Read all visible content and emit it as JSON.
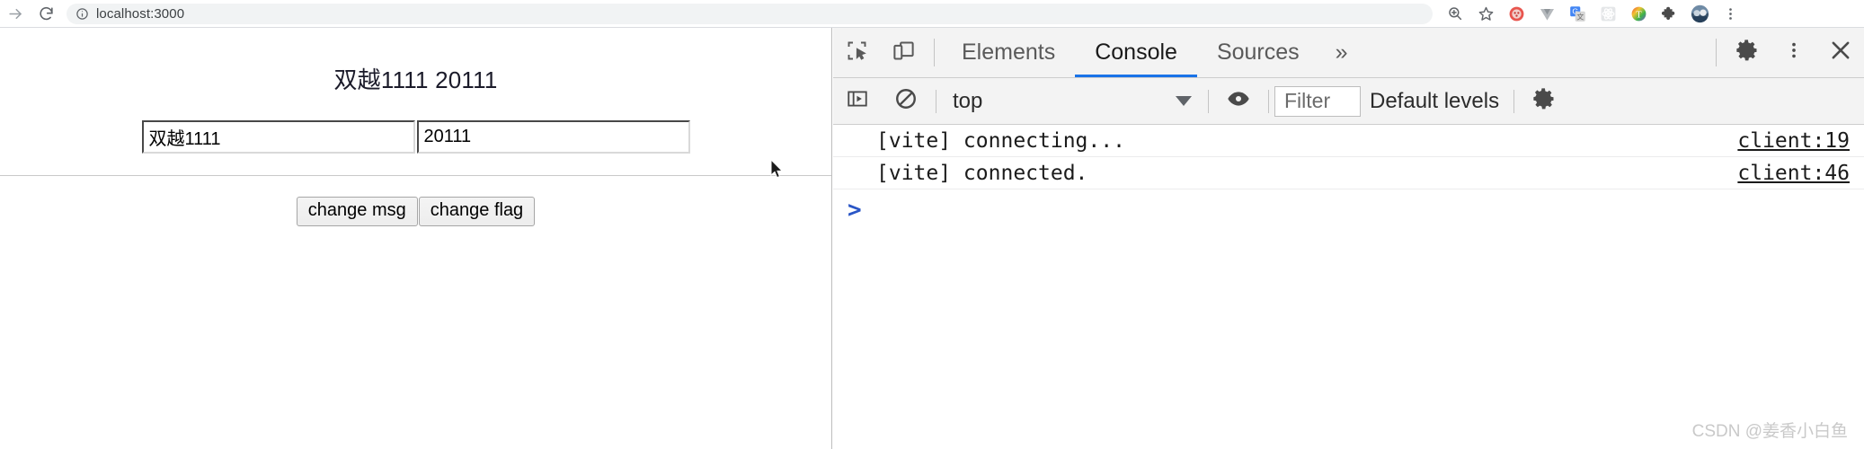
{
  "browser": {
    "forward_icon": "arrow-forward-icon",
    "reload_icon": "reload-icon",
    "omnibox": {
      "info_icon": "site-info-icon",
      "url": "localhost:3000"
    },
    "toolbar_icons": [
      {
        "name": "zoom-icon",
        "glyph": "search"
      },
      {
        "name": "bookmark-star-icon",
        "glyph": "star"
      },
      {
        "name": "extension-octopus-icon",
        "glyph": "red-circle"
      },
      {
        "name": "extension-vue-devtools-icon",
        "glyph": "gray-v"
      },
      {
        "name": "extension-google-translate-icon",
        "glyph": "g-translate"
      },
      {
        "name": "extension-react-devtools-icon",
        "glyph": "gray-dots"
      },
      {
        "name": "extension-colorful-t-icon",
        "glyph": "rainbow-t"
      },
      {
        "name": "extensions-puzzle-icon",
        "glyph": "puzzle"
      },
      {
        "name": "profile-avatar",
        "glyph": "avatar"
      },
      {
        "name": "chrome-menu-icon",
        "glyph": "kebab"
      }
    ]
  },
  "page": {
    "heading": "双越1111 20111",
    "inputs": [
      {
        "name": "msg-input",
        "value": "双越1111"
      },
      {
        "name": "flag-input",
        "value": "20111"
      }
    ],
    "buttons": [
      {
        "name": "change-msg-button",
        "label": "change msg"
      },
      {
        "name": "change-flag-button",
        "label": "change flag"
      }
    ]
  },
  "devtools": {
    "left_icons": [
      {
        "name": "inspect-element-icon"
      },
      {
        "name": "device-toolbar-icon"
      }
    ],
    "tabs": [
      {
        "label": "Elements",
        "active": false
      },
      {
        "label": "Console",
        "active": true
      },
      {
        "label": "Sources",
        "active": false
      }
    ],
    "more_tabs_label": "»",
    "right_icons": [
      {
        "name": "settings-gear-icon"
      },
      {
        "name": "devtools-menu-icon"
      },
      {
        "name": "close-devtools-icon"
      }
    ],
    "console_toolbar": {
      "sidebar_toggle_icon": "console-sidebar-icon",
      "clear_console_icon": "clear-console-icon",
      "context_label": "top",
      "live_expression_icon": "eye-icon",
      "filter_placeholder": "Filter",
      "levels_label": "Default levels",
      "settings_icon": "console-settings-gear-icon"
    },
    "messages": [
      {
        "text": "[vite] connecting...",
        "source": "client:19"
      },
      {
        "text": "[vite] connected.",
        "source": "client:46"
      }
    ],
    "prompt": ">"
  },
  "watermark": "CSDN @姜香小白鱼",
  "colors": {
    "accent_blue": "#1a73e8",
    "prompt_blue": "#2a56c6",
    "chrome_bg": "#f3f3f3"
  }
}
